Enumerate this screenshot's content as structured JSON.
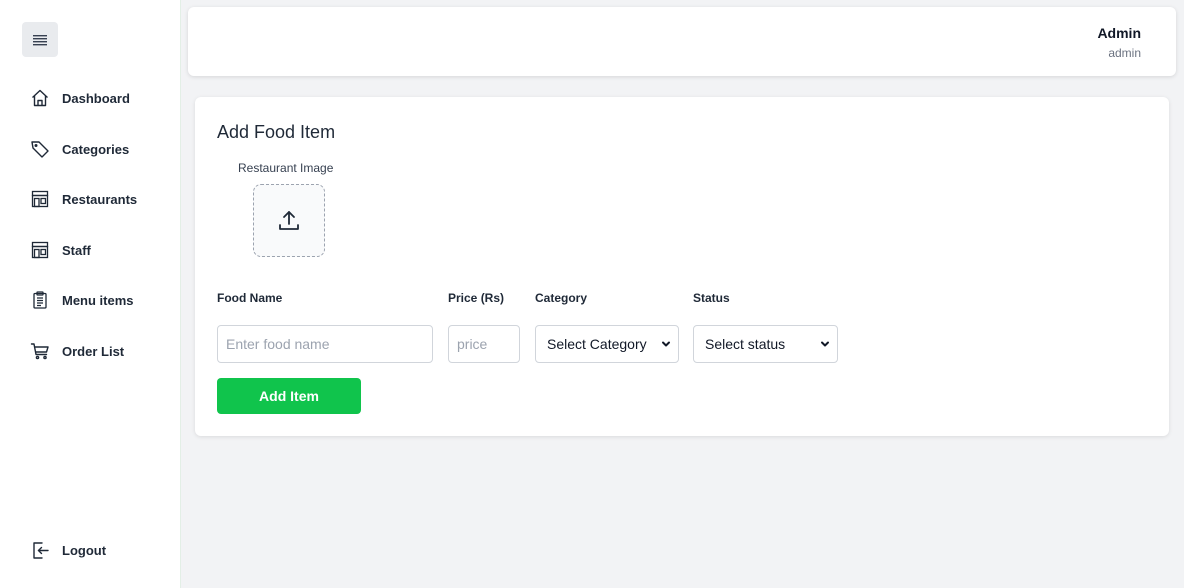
{
  "sidebar": {
    "items": [
      {
        "label": "Dashboard",
        "icon": "home-icon"
      },
      {
        "label": "Categories",
        "icon": "tag-icon"
      },
      {
        "label": "Restaurants",
        "icon": "store-icon"
      },
      {
        "label": "Staff",
        "icon": "store-icon"
      },
      {
        "label": "Menu items",
        "icon": "clipboard-icon"
      },
      {
        "label": "Order List",
        "icon": "cart-icon"
      }
    ],
    "logout_label": "Logout"
  },
  "header": {
    "user_name": "Admin",
    "user_role": "admin"
  },
  "form": {
    "title": "Add Food Item",
    "image_label": "Restaurant Image",
    "food_name_label": "Food Name",
    "food_name_placeholder": "Enter food name",
    "food_name_value": "",
    "price_label": "Price (Rs)",
    "price_placeholder": "price",
    "price_value": "",
    "category_label": "Category",
    "category_selected": "Select Category",
    "status_label": "Status",
    "status_selected": "Select status",
    "submit_label": "Add Item"
  },
  "colors": {
    "accent_green": "#10c44c",
    "page_bg": "#f2f3f5",
    "sidebar_border": "#e3efe6"
  }
}
